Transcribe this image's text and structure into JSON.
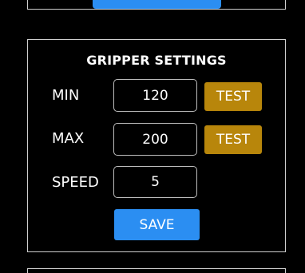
{
  "gripper": {
    "title": "GRIPPER SETTINGS",
    "min": {
      "label": "MIN",
      "value": "120",
      "test_label": "TEST"
    },
    "max": {
      "label": "MAX",
      "value": "200",
      "test_label": "TEST"
    },
    "speed": {
      "label": "SPEED",
      "value": "5"
    },
    "save_label": "SAVE"
  },
  "colors": {
    "background": "#000000",
    "panel_border": "#cfcfcf",
    "primary_button": "#2b8ef2",
    "test_button": "#b8860b",
    "text": "#ffffff"
  }
}
